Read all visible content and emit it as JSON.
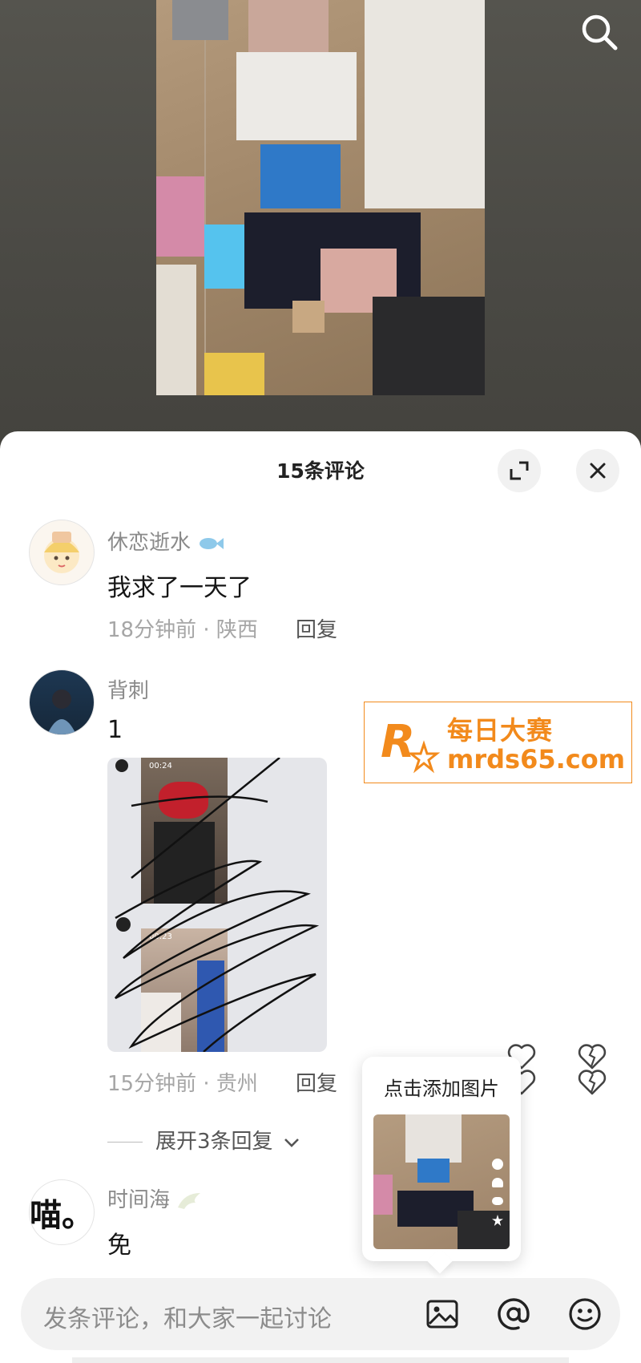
{
  "sheet": {
    "title": "15条评论",
    "expand_icon": "expand-icon",
    "close_icon": "close-icon"
  },
  "comments": [
    {
      "username": "休恋逝水",
      "text": "我求了一天了",
      "meta": "18分钟前 · 陕西",
      "reply_label": "回复"
    },
    {
      "username": "背刺",
      "text": "1",
      "meta": "15分钟前 · 贵州",
      "reply_label": "回复",
      "image_timestamps": [
        "00:24",
        "00:23"
      ],
      "expand_replies": "展开3条回复"
    },
    {
      "username": "时间海",
      "avatar_text": "喵。",
      "text": "免"
    }
  ],
  "watermark": {
    "brand_cn": "每日大赛",
    "url": "mrds65.com",
    "logo_letter": "R",
    "logo_small": "每日大赛"
  },
  "popup": {
    "label": "点击添加图片"
  },
  "input": {
    "placeholder": "发条评论，和大家一起讨论"
  },
  "colors": {
    "accent": "#f28a1c",
    "sheet_bg": "#ffffff",
    "video_bg": "#4b4a45"
  }
}
